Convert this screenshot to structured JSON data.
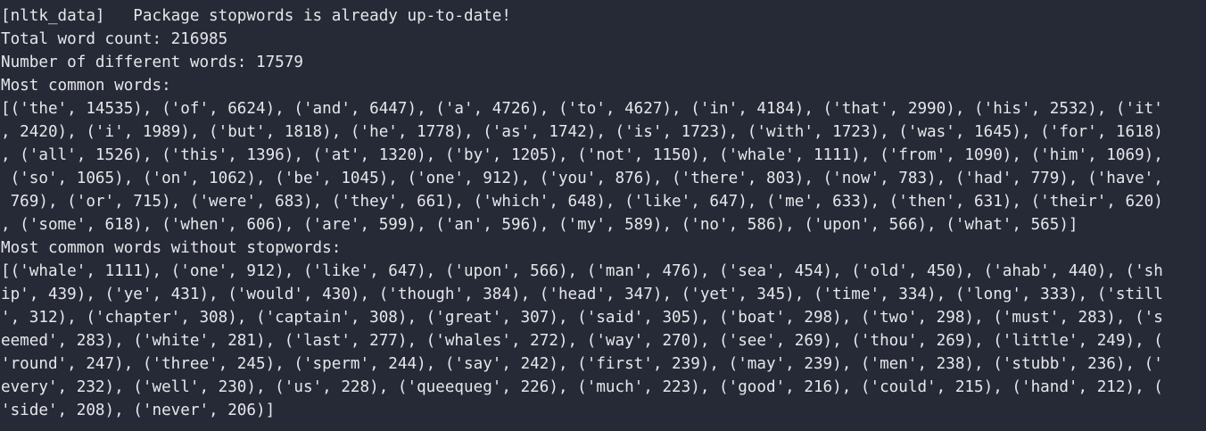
{
  "terminal": {
    "lines": [
      "[nltk_data]   Package stopwords is already up-to-date!",
      "Total word count: 216985",
      "Number of different words: 17579",
      "Most common words:",
      "[('the', 14535), ('of', 6624), ('and', 6447), ('a', 4726), ('to', 4627), ('in', 4184), ('that', 2990), ('his', 2532), ('it'",
      ", 2420), ('i', 1989), ('but', 1818), ('he', 1778), ('as', 1742), ('is', 1723), ('with', 1723), ('was', 1645), ('for', 1618)",
      ", ('all', 1526), ('this', 1396), ('at', 1320), ('by', 1205), ('not', 1150), ('whale', 1111), ('from', 1090), ('him', 1069),",
      " ('so', 1065), ('on', 1062), ('be', 1045), ('one', 912), ('you', 876), ('there', 803), ('now', 783), ('had', 779), ('have',",
      " 769), ('or', 715), ('were', 683), ('they', 661), ('which', 648), ('like', 647), ('me', 633), ('then', 631), ('their', 620)",
      ", ('some', 618), ('when', 606), ('are', 599), ('an', 596), ('my', 589), ('no', 586), ('upon', 566), ('what', 565)]",
      "Most common words without stopwords:",
      "[('whale', 1111), ('one', 912), ('like', 647), ('upon', 566), ('man', 476), ('sea', 454), ('old', 450), ('ahab', 440), ('sh",
      "ip', 439), ('ye', 431), ('would', 430), ('though', 384), ('head', 347), ('yet', 345), ('time', 334), ('long', 333), ('still",
      "', 312), ('chapter', 308), ('captain', 308), ('great', 307), ('said', 305), ('boat', 298), ('two', 298), ('must', 283), ('s",
      "eemed', 283), ('white', 281), ('last', 277), ('whales', 272), ('way', 270), ('see', 269), ('thou', 269), ('little', 249), (",
      "'round', 247), ('three', 245), ('sperm', 244), ('say', 242), ('first', 239), ('may', 239), ('men', 238), ('stubb', 236), ('",
      "every', 232), ('well', 230), ('us', 228), ('queequeg', 226), ('much', 223), ('good', 216), ('could', 215), ('hand', 212), (",
      "'side', 208), ('never', 206)]"
    ]
  },
  "colors": {
    "background": "#262a36",
    "text": "#e6e7eb"
  }
}
